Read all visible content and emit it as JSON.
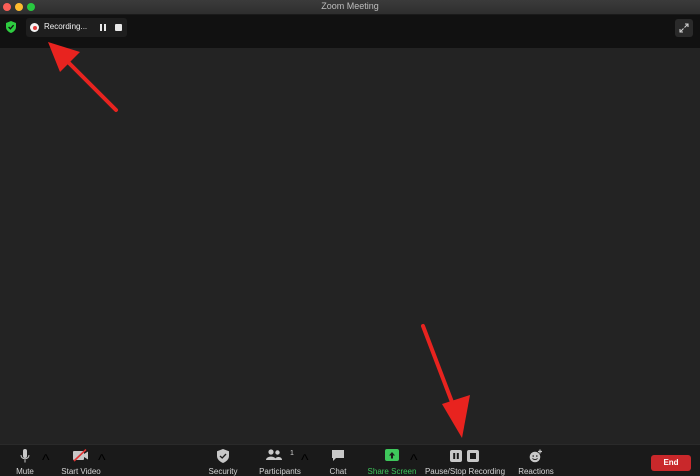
{
  "window": {
    "title": "Zoom Meeting"
  },
  "topbar": {
    "recording_label": "Recording...",
    "icons": {
      "security": "shield-check-icon",
      "record": "record-dot-icon",
      "pause": "pause-icon",
      "stop": "stop-icon",
      "fullscreen": "fullscreen-icon"
    }
  },
  "toolbar": {
    "mute": {
      "label": "Mute",
      "icon": "microphone-icon"
    },
    "start_video": {
      "label": "Start Video",
      "icon": "video-off-icon"
    },
    "security": {
      "label": "Security",
      "icon": "shield-icon"
    },
    "participants": {
      "label": "Participants",
      "count": "1",
      "icon": "participants-icon"
    },
    "chat": {
      "label": "Chat",
      "icon": "chat-icon"
    },
    "share_screen": {
      "label": "Share Screen",
      "icon": "share-screen-icon"
    },
    "recording": {
      "label": "Pause/Stop Recording",
      "icon": "pause-stop-icon"
    },
    "reactions": {
      "label": "Reactions",
      "icon": "reactions-icon"
    },
    "end": {
      "label": "End"
    }
  },
  "colors": {
    "background": "#232323",
    "toolbar": "#1a1a1a",
    "share_green": "#3ec75b",
    "end_red": "#c9282b",
    "arrow_red": "#e8231f"
  }
}
